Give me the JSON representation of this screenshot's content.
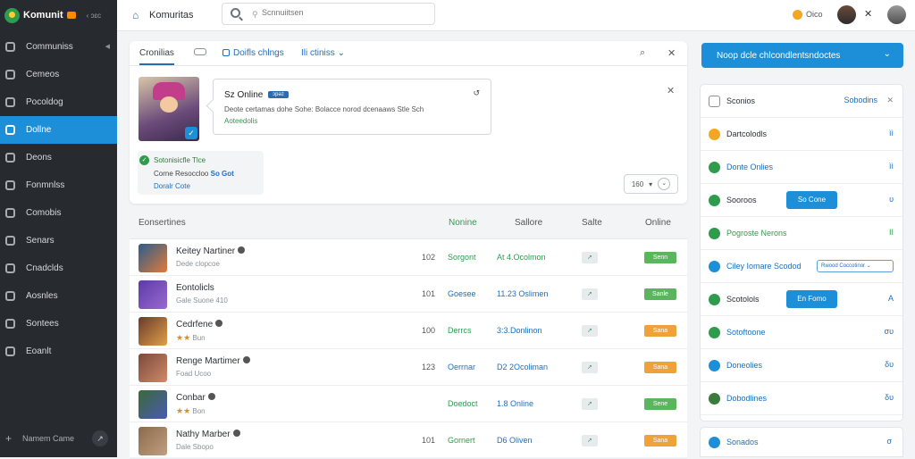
{
  "sidebar": {
    "brand": "Komunit",
    "brand_extra": "‹ ɔɛc",
    "items": [
      {
        "label": "Communiss"
      },
      {
        "label": "Cemeos"
      },
      {
        "label": "Pocoldog"
      },
      {
        "label": "Dollne"
      },
      {
        "label": "Deons"
      },
      {
        "label": "Fonmnlss"
      },
      {
        "label": "Comobis"
      },
      {
        "label": "Senars"
      },
      {
        "label": "Cnadclds"
      },
      {
        "label": "Aosnles"
      },
      {
        "label": "Sontees"
      },
      {
        "label": "Eoanlt"
      }
    ],
    "footer": "Namem Came"
  },
  "topbar": {
    "title": "Komuritas",
    "search_placeholder": "Scnnuiitsen",
    "coin_label": "Oico"
  },
  "panel": {
    "tabs": [
      "Cronilias",
      "Doifls chlngs",
      "Ili ctiniss"
    ],
    "popup": {
      "title": "Sz Online",
      "badge": "ɔpəz",
      "desc": "Deote certamas dohe Sohe: Bolacce norod dcenaaws Stle Sch",
      "link": "Aoteedolis"
    },
    "status": {
      "line1": "Sotonisicfle Tlce",
      "line2_a": "Corne Resoccloo",
      "line2_b": "So Got",
      "line3": "Doralr Cote"
    },
    "dropdown": "160"
  },
  "table": {
    "headers": [
      "Eonsertines",
      "Nonine",
      "Sallore",
      "Salte",
      "Online"
    ],
    "rows": [
      {
        "name": "Keitey Nartiner",
        "verified": true,
        "sub": "Dede clopcoe",
        "stars": "",
        "num": "102",
        "c1": "Sorgont",
        "c1_color": "green",
        "c2": "At 4.Ocolmon",
        "c2_color": "green",
        "pill": "Senn",
        "pill_color": "#5bb55d",
        "avatar": [
          "#2a5d8c",
          "#e07a3a"
        ]
      },
      {
        "name": "Eontolicls",
        "verified": false,
        "sub": "Gale Suone 410",
        "stars": "",
        "num": "101",
        "c1": "Goesee",
        "c1_color": "blue",
        "c2": "11.23 Oslimen",
        "c2_color": "blue",
        "pill": "Sanle",
        "pill_color": "#5bb55d",
        "avatar": [
          "#5b3aa8",
          "#9a6ad0"
        ]
      },
      {
        "name": "Cedrfene",
        "verified": true,
        "sub": "Bun",
        "stars": "★★",
        "num": "100",
        "c1": "Derrcs",
        "c1_color": "green",
        "c2": "3:3.Donlinon",
        "c2_color": "blue",
        "pill": "Sana",
        "pill_color": "#f0a23a",
        "avatar": [
          "#6a3a2a",
          "#e0a04a"
        ]
      },
      {
        "name": "Renge Martimer",
        "verified": true,
        "sub": "Foad Ucoo",
        "stars": "",
        "num": "123",
        "c1": "Oerrnar",
        "c1_color": "blue",
        "c2": "D2 2Ocoliman",
        "c2_color": "blue",
        "pill": "Sana",
        "pill_color": "#f0a23a",
        "avatar": [
          "#7a4a3a",
          "#d08a6a"
        ]
      },
      {
        "name": "Conbar",
        "verified": true,
        "sub": "Bon",
        "stars": "★★",
        "num": "",
        "c1": "Doedoct",
        "c1_color": "green",
        "c2": "1.8 Online",
        "c2_color": "blue",
        "pill": "Sene",
        "pill_color": "#5bb55d",
        "avatar": [
          "#3a6a3a",
          "#4a5ab0"
        ]
      },
      {
        "name": "Nathy Marber",
        "verified": true,
        "sub": "Dale Sbopo",
        "stars": "",
        "num": "101",
        "c1": "Gornert",
        "c1_color": "green",
        "c2": "D6 Oliven",
        "c2_color": "blue",
        "pill": "Sana",
        "pill_color": "#f0a23a",
        "avatar": [
          "#8a6a4a",
          "#c0a080"
        ]
      }
    ]
  },
  "right": {
    "button": "Noop dcle chlcondlentsndoctes",
    "rows": [
      {
        "label": "Sconios",
        "right": "Sobodins",
        "right_kind": "link",
        "icon": "outline",
        "extra": "✕"
      },
      {
        "label": "Dartcolodls",
        "right": "ìì",
        "right_kind": "text",
        "icon": "#f4a623",
        "extra": ""
      },
      {
        "label": "Donte Onlies",
        "right": "ìì",
        "right_kind": "text",
        "icon": "#2e9c4c",
        "extra": "",
        "blue": true
      },
      {
        "label": "Sooroos",
        "right": "υ",
        "right_kind": "text",
        "icon": "#2e9c4c",
        "extra": "",
        "button": "So Cone"
      },
      {
        "label": "Pogroste Nerons",
        "right": "II",
        "right_kind": "text",
        "icon": "#2e9c4c",
        "extra": "",
        "green": true
      },
      {
        "label": "Ciley Iomare Scodod",
        "right": "",
        "right_kind": "text",
        "icon": "#1d8ed8",
        "extra": "",
        "blue": true,
        "select": "Rwood Coccotinor"
      },
      {
        "label": "Scotolols",
        "right": "A",
        "right_kind": "text",
        "icon": "#2e9c4c",
        "extra": "",
        "button": "En Fomo"
      },
      {
        "label": "Sotoftoone",
        "right": "συ",
        "right_kind": "text",
        "icon": "#2e9c4c",
        "extra": "",
        "blue": true
      },
      {
        "label": "Doneolies",
        "right": "δυ",
        "right_kind": "text",
        "icon": "#1d8ed8",
        "extra": "",
        "blue": true
      },
      {
        "label": "Dobodlines",
        "right": "δυ",
        "right_kind": "text",
        "icon": "#3a7a3a",
        "extra": "",
        "blue": true
      }
    ],
    "last": {
      "label": "Sonados",
      "right": "σ"
    }
  }
}
